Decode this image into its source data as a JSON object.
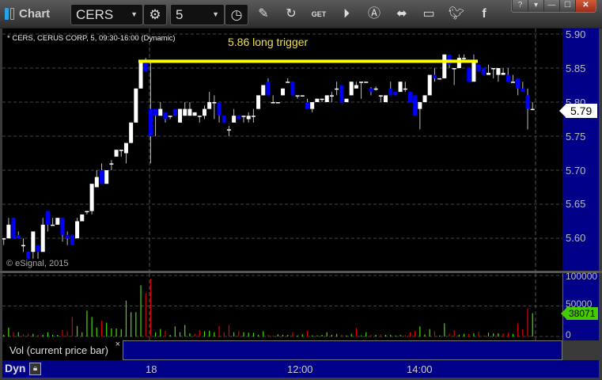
{
  "app": {
    "title": "Chart"
  },
  "toolbar": {
    "symbol": "CERS",
    "interval": "5",
    "icons": [
      "gear-icon",
      "clock-icon",
      "pencil-icon",
      "refresh-icon",
      "get-icon",
      "play-icon",
      "alert-icon",
      "link-icon",
      "comment-icon",
      "twitter-icon",
      "facebook-icon"
    ],
    "window_buttons": [
      "?",
      "▾",
      "—",
      "☐",
      "✕"
    ]
  },
  "chart": {
    "header": "* CERS, CERUS CORP, 5, 09:30-16:00 (Dynamic)",
    "annotation": "5.86 long trigger",
    "annotation_price": 5.86,
    "annotation_color": "#ffff00",
    "copyright": "© eSignal, 2015",
    "last_price": "5.79",
    "price_ticks": [
      "5.90",
      "5.85",
      "5.80",
      "5.75",
      "5.70",
      "5.65",
      "5.60"
    ],
    "volume_ticks": [
      "100000",
      "50000",
      "0"
    ],
    "last_volume": "38071",
    "volume_legend": "Vol (current price bar)",
    "legend_close": "×",
    "time_labels": [
      "18",
      "12:00",
      "14:00"
    ],
    "dyn_label": "Dyn",
    "colors": {
      "up": "#ffffff",
      "down": "#0000ff",
      "vol_up": "#44dd00",
      "vol_down": "#dd0000",
      "axis_bg": "#000088"
    }
  },
  "chart_data": {
    "type": "candlestick",
    "ylim": [
      5.55,
      5.9
    ],
    "volume_ylim": [
      0,
      100000
    ],
    "ohlc": [
      [
        5.6,
        5.6,
        5.59,
        5.6
      ],
      [
        5.6,
        5.63,
        5.6,
        5.62
      ],
      [
        5.63,
        5.63,
        5.6,
        5.6
      ],
      [
        5.605,
        5.61,
        5.6,
        5.6
      ],
      [
        5.59,
        5.6,
        5.58,
        5.59
      ],
      [
        5.58,
        5.58,
        5.57,
        5.57
      ],
      [
        5.58,
        5.61,
        5.57,
        5.61
      ],
      [
        5.59,
        5.59,
        5.57,
        5.58
      ],
      [
        5.58,
        5.63,
        5.58,
        5.62
      ],
      [
        5.64,
        5.64,
        5.61,
        5.62
      ],
      [
        5.62,
        5.63,
        5.62,
        5.62
      ],
      [
        5.62,
        5.63,
        5.62,
        5.63
      ],
      [
        5.63,
        5.63,
        5.595,
        5.605
      ],
      [
        5.605,
        5.61,
        5.59,
        5.6
      ],
      [
        5.605,
        5.605,
        5.59,
        5.59
      ],
      [
        5.6,
        5.63,
        5.6,
        5.625
      ],
      [
        5.625,
        5.635,
        5.625,
        5.635
      ],
      [
        5.64,
        5.64,
        5.635,
        5.64
      ],
      [
        5.64,
        5.68,
        5.635,
        5.68
      ],
      [
        5.675,
        5.7,
        5.675,
        5.69
      ],
      [
        5.7,
        5.71,
        5.68,
        5.68
      ],
      [
        5.68,
        5.7,
        5.68,
        5.7
      ],
      [
        5.71,
        5.715,
        5.7,
        5.71
      ],
      [
        5.72,
        5.73,
        5.72,
        5.73
      ],
      [
        5.73,
        5.73,
        5.72,
        5.73
      ],
      [
        5.725,
        5.74,
        5.71,
        5.74
      ],
      [
        5.74,
        5.77,
        5.74,
        5.77
      ],
      [
        5.77,
        5.82,
        5.77,
        5.82
      ],
      [
        5.82,
        5.86,
        5.82,
        5.86
      ],
      [
        5.86,
        5.865,
        5.845,
        5.845
      ],
      [
        5.79,
        5.86,
        5.71,
        5.75
      ],
      [
        5.79,
        5.79,
        5.75,
        5.78
      ],
      [
        5.78,
        5.8,
        5.78,
        5.79
      ],
      [
        5.785,
        5.785,
        5.77,
        5.775
      ],
      [
        5.78,
        5.78,
        5.775,
        5.78
      ],
      [
        5.79,
        5.79,
        5.78,
        5.78
      ],
      [
        5.77,
        5.79,
        5.77,
        5.79
      ],
      [
        5.78,
        5.8,
        5.78,
        5.79
      ],
      [
        5.78,
        5.8,
        5.78,
        5.79
      ],
      [
        5.78,
        5.785,
        5.78,
        5.785
      ],
      [
        5.78,
        5.78,
        5.77,
        5.78
      ],
      [
        5.78,
        5.795,
        5.775,
        5.79
      ],
      [
        5.79,
        5.815,
        5.79,
        5.8
      ],
      [
        5.8,
        5.81,
        5.775,
        5.8
      ],
      [
        5.8,
        5.8,
        5.77,
        5.78
      ],
      [
        5.78,
        5.78,
        5.77,
        5.77
      ],
      [
        5.76,
        5.765,
        5.75,
        5.76
      ],
      [
        5.77,
        5.79,
        5.77,
        5.78
      ],
      [
        5.78,
        5.78,
        5.775,
        5.775
      ],
      [
        5.78,
        5.78,
        5.77,
        5.78
      ],
      [
        5.775,
        5.785,
        5.77,
        5.78
      ],
      [
        5.78,
        5.79,
        5.77,
        5.78
      ],
      [
        5.79,
        5.81,
        5.79,
        5.81
      ],
      [
        5.81,
        5.825,
        5.81,
        5.825
      ],
      [
        5.83,
        5.835,
        5.81,
        5.81
      ],
      [
        5.8,
        5.81,
        5.8,
        5.8
      ],
      [
        5.8,
        5.8,
        5.8,
        5.8
      ],
      [
        5.81,
        5.82,
        5.81,
        5.82
      ],
      [
        5.83,
        5.835,
        5.83,
        5.83
      ],
      [
        5.83,
        5.83,
        5.81,
        5.81
      ],
      [
        5.81,
        5.81,
        5.805,
        5.81
      ],
      [
        5.81,
        5.81,
        5.81,
        5.81
      ],
      [
        5.8,
        5.805,
        5.79,
        5.79
      ],
      [
        5.79,
        5.8,
        5.785,
        5.8
      ],
      [
        5.8,
        5.805,
        5.8,
        5.805
      ],
      [
        5.805,
        5.805,
        5.8,
        5.805
      ],
      [
        5.8,
        5.81,
        5.8,
        5.81
      ],
      [
        5.81,
        5.815,
        5.8,
        5.81
      ],
      [
        5.82,
        5.83,
        5.81,
        5.82
      ],
      [
        5.825,
        5.825,
        5.8,
        5.8
      ],
      [
        5.8,
        5.805,
        5.8,
        5.805
      ],
      [
        5.81,
        5.83,
        5.81,
        5.83
      ],
      [
        5.82,
        5.83,
        5.82,
        5.825
      ],
      [
        5.83,
        5.83,
        5.805,
        5.83
      ],
      [
        5.83,
        5.83,
        5.83,
        5.83
      ],
      [
        5.82,
        5.822,
        5.81,
        5.815
      ],
      [
        5.82,
        5.823,
        5.817,
        5.82
      ],
      [
        5.81,
        5.81,
        5.8,
        5.81
      ],
      [
        5.8,
        5.81,
        5.8,
        5.81
      ],
      [
        5.82,
        5.83,
        5.81,
        5.81
      ],
      [
        5.815,
        5.815,
        5.81,
        5.81
      ],
      [
        5.815,
        5.83,
        5.815,
        5.83
      ],
      [
        5.82,
        5.83,
        5.815,
        5.82
      ],
      [
        5.815,
        5.815,
        5.8,
        5.8
      ],
      [
        5.81,
        5.81,
        5.78,
        5.78
      ],
      [
        5.79,
        5.8,
        5.76,
        5.8
      ],
      [
        5.8,
        5.81,
        5.8,
        5.81
      ],
      [
        5.81,
        5.84,
        5.81,
        5.84
      ],
      [
        5.84,
        5.85,
        5.83,
        5.835
      ],
      [
        5.835,
        5.835,
        5.835,
        5.835
      ],
      [
        5.835,
        5.87,
        5.835,
        5.87
      ],
      [
        5.87,
        5.87,
        5.85,
        5.855
      ],
      [
        5.85,
        5.85,
        5.825,
        5.85
      ],
      [
        5.85,
        5.87,
        5.85,
        5.865
      ],
      [
        5.865,
        5.87,
        5.86,
        5.865
      ],
      [
        5.85,
        5.85,
        5.83,
        5.83
      ],
      [
        5.83,
        5.87,
        5.83,
        5.86
      ],
      [
        5.855,
        5.855,
        5.845,
        5.845
      ],
      [
        5.85,
        5.85,
        5.84,
        5.84
      ],
      [
        5.84,
        5.855,
        5.84,
        5.843
      ],
      [
        5.85,
        5.85,
        5.835,
        5.85
      ],
      [
        5.84,
        5.85,
        5.83,
        5.85
      ],
      [
        5.84,
        5.85,
        5.84,
        5.843
      ],
      [
        5.84,
        5.85,
        5.83,
        5.83
      ],
      [
        5.83,
        5.84,
        5.83,
        5.83
      ],
      [
        5.835,
        5.835,
        5.81,
        5.82
      ],
      [
        5.82,
        5.83,
        5.815,
        5.815
      ],
      [
        5.81,
        5.82,
        5.76,
        5.79
      ],
      [
        5.79,
        5.8,
        5.79,
        5.79
      ]
    ],
    "volume": [
      2600,
      14700,
      7000,
      7000,
      3500,
      5200,
      4300,
      2600,
      2600,
      7000,
      2600,
      2600,
      10400,
      8700,
      32000,
      17300,
      7000,
      42400,
      32000,
      14700,
      26000,
      22500,
      13000,
      13000,
      12100,
      58900,
      39800,
      39800,
      84000,
      71000,
      94400,
      7000,
      12100,
      9500,
      2600,
      16500,
      7000,
      19000,
      5200,
      4300,
      10400,
      8700,
      9500,
      7000,
      17300,
      7000,
      19000,
      7000,
      8700,
      7000,
      6100,
      6100,
      2600,
      8700,
      2600,
      1700,
      3500,
      2600,
      2600,
      7000,
      1700,
      3500,
      9500,
      1700,
      1700,
      2600,
      7000,
      2600,
      4300,
      2600,
      1700,
      4300,
      13900,
      1700,
      7000,
      2600,
      2600,
      3500,
      2600,
      2600,
      1700,
      2600,
      2600,
      7000,
      9500,
      16500,
      3500,
      12100,
      8700,
      1700,
      21600,
      4300,
      10400,
      2600,
      4300,
      4300,
      5200,
      7800,
      1700,
      6100,
      5200,
      5200,
      5200,
      6100,
      4300,
      21600,
      12100,
      45900,
      38071
    ]
  }
}
